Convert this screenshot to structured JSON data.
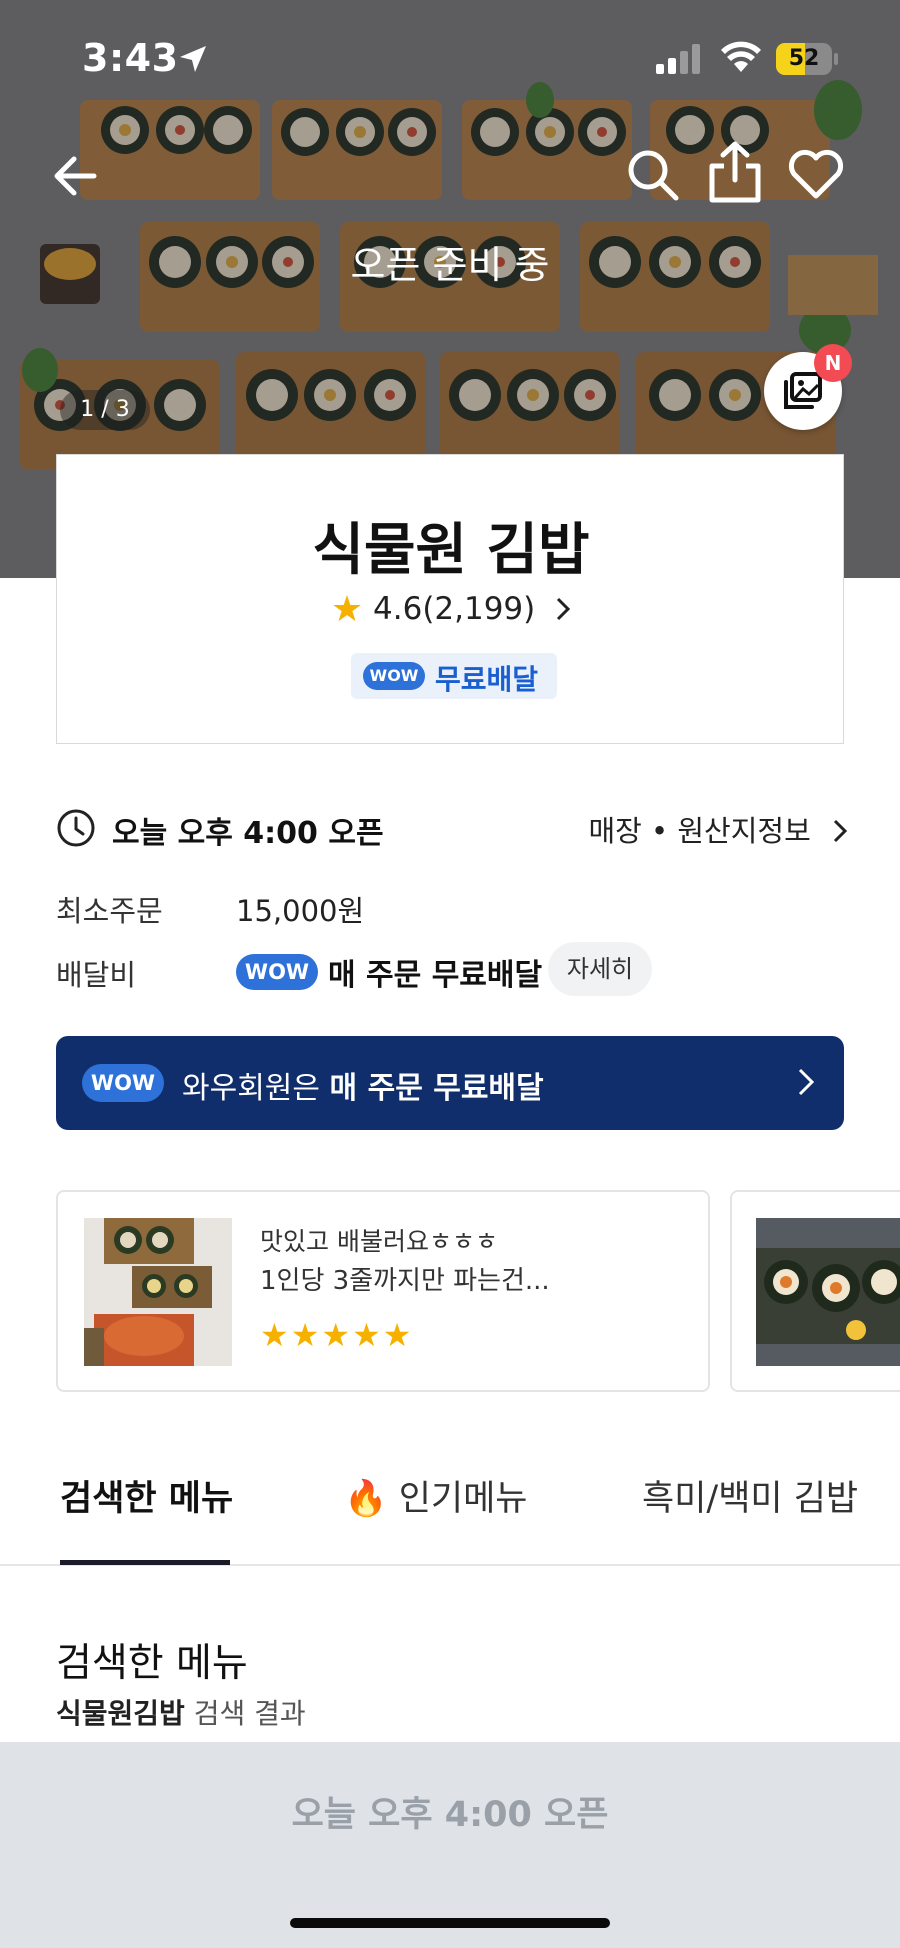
{
  "status_bar": {
    "time": "3:43",
    "battery": "52",
    "battery_level": 0.52
  },
  "hero": {
    "status_text": "오픈 준비 중",
    "photo_counter": "1 / 3",
    "new_badge": "N"
  },
  "store": {
    "name": "식물원 김밥",
    "rating_text": "4.6(2,199)",
    "wow_label": "WOW",
    "free_delivery": "무료배달"
  },
  "info": {
    "open_time": "오늘 오후 4:00 오픈",
    "store_info_link": "매장 • 원산지정보",
    "min_order_label": "최소주문",
    "min_order_value": "15,000원",
    "delivery_fee_label": "배달비",
    "wow_label": "WOW",
    "delivery_fee_value": "매 주문 무료배달",
    "detail_button": "자세히"
  },
  "wow_banner": {
    "wow_label": "WOW",
    "text_prefix": "와우회원은 ",
    "text_bold": "매 주문 무료배달"
  },
  "reviews": [
    {
      "line1": "맛있고 배불러요ㅎㅎㅎ",
      "line2": "1인당 3줄까지만 파는건...",
      "stars": "★★★★★",
      "rating": 5
    }
  ],
  "tabs": [
    {
      "label": "검색한 메뉴",
      "active": true
    },
    {
      "label": "🔥 인기메뉴",
      "active": false
    },
    {
      "label": "흑미/백미 김밥",
      "active": false
    }
  ],
  "section": {
    "title": "검색한 메뉴",
    "sub_bold": "식물원김밥",
    "sub_rest": " 검색 결과"
  },
  "bottom": {
    "label": "오늘 오후 4:00 오픈"
  },
  "colors": {
    "wow_blue": "#2e71d9",
    "banner_navy": "#0f2e6b",
    "star": "#f6b100",
    "badge_red": "#f24b53"
  }
}
